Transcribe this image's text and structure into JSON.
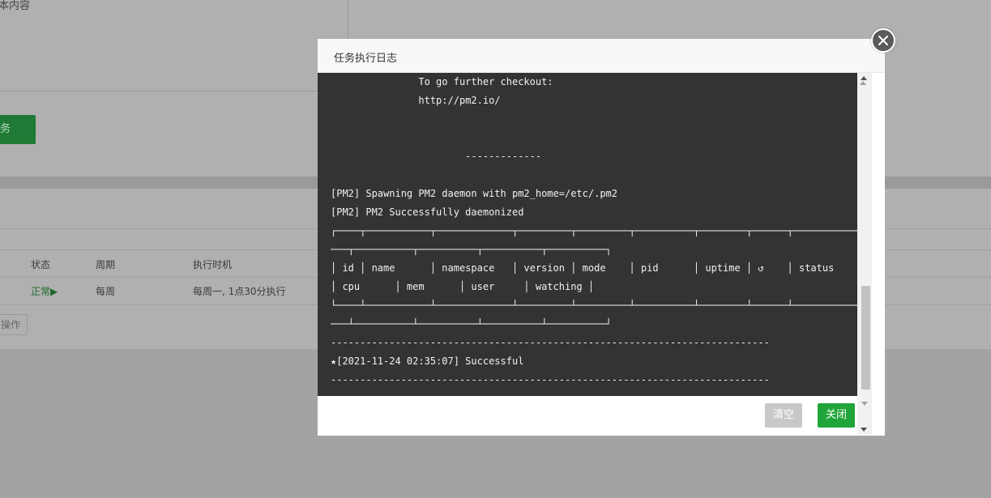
{
  "background": {
    "textarea_label": "本内容",
    "add_button_label": "务",
    "table": {
      "headers": {
        "status": "状态",
        "period": "周期",
        "exec_time": "执行时机"
      },
      "row": {
        "status": "正常▶",
        "period": "每周",
        "exec_time": "每周一, 1点30分执行"
      }
    },
    "ops_button": "操作"
  },
  "modal": {
    "title": "任务执行日志",
    "log_lines": [
      "               To go further checkout:",
      "               http://pm2.io/",
      "",
      "",
      "                       -------------",
      "",
      "[PM2] Spawning PM2 daemon with pm2_home=/etc/.pm2",
      "[PM2] PM2 Successfully daemonized",
      "┌────┬───────────┬─────────────┬─────────┬─────────┬──────────┬────────┬──────┬───────────",
      "───┬──────────┬──────────┬──────────┬──────────┐",
      "│ id │ name      │ namespace   │ version │ mode    │ pid      │ uptime │ ↺    │ status",
      "│ cpu      │ mem      │ user     │ watching │",
      "└────┴───────────┴─────────────┴─────────┴─────────┴──────────┴────────┴──────┴───────────",
      "───┴──────────┴──────────┴──────────┴──────────┘",
      "---------------------------------------------------------------------------",
      "★[2021-11-24 02:35:07] Successful",
      "---------------------------------------------------------------------------"
    ],
    "buttons": {
      "clear": "清空",
      "close": "关闭"
    }
  },
  "colors": {
    "overlay": "#a3a3a3",
    "log_background": "#333333",
    "primary_green": "#20a53a",
    "disabled_gray": "#c8c8c8"
  }
}
